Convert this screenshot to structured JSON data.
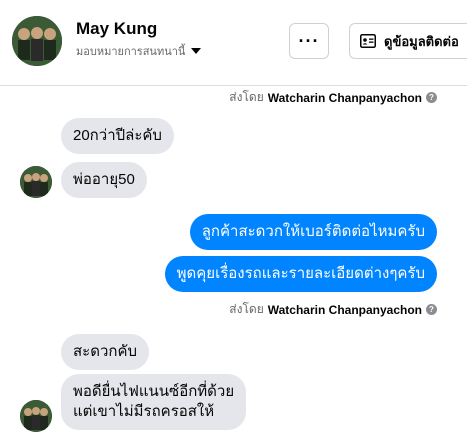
{
  "header": {
    "name": "May Kung",
    "subtitle": "มอบหมายการสนทนานี้",
    "more_label": "···",
    "contact_label": "ดูข้อมูลติดต่อ"
  },
  "sent_by": {
    "prefix": "ส่งโดย",
    "name": "Watcharin Chanpanyachon",
    "info_glyph": "?"
  },
  "messages": [
    {
      "direction": "incoming",
      "text": "20กว่าปีล่ะคับ"
    },
    {
      "direction": "incoming",
      "text": "พ่ออายุ50"
    },
    {
      "direction": "outgoing",
      "text": "ลูกค้าสะดวกให้เบอร์ติดต่อไหมครับ"
    },
    {
      "direction": "outgoing",
      "text": "พูดคุยเรื่องรถและรายละเอียดต่างๆครับ"
    },
    {
      "direction": "incoming",
      "text": "สะดวกคับ"
    },
    {
      "direction": "incoming",
      "lines": [
        "พอดียื่นไฟแนนซ์อีกที่ด้วย",
        "แต่เขาไม่มีรถครอสให้"
      ]
    }
  ],
  "colors": {
    "incoming_bubble": "#e4e6eb",
    "outgoing_bubble": "#0084ff",
    "secondary_text": "#65676b"
  },
  "icons": {
    "more": "more-horizontal-icon",
    "contact": "contact-card-icon",
    "caret": "caret-down-icon",
    "info": "info-icon"
  }
}
